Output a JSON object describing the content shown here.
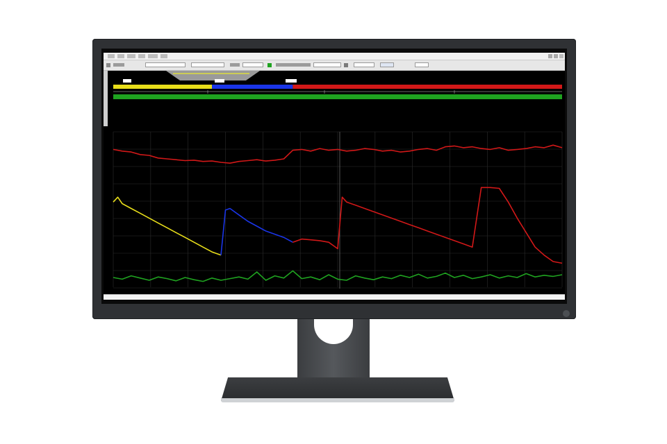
{
  "theme": {
    "bezel": "#2f3134",
    "plot_background": "#000000",
    "grid": "#2c2c2c",
    "colors": {
      "red": "#d21818",
      "yellow": "#e8de1a",
      "blue": "#1a35e8",
      "green": "#1fa320"
    }
  },
  "overview": {
    "timeline_segments": [
      {
        "name": "segment-yellow",
        "color": "#e8de1a",
        "from": 0.0,
        "to": 0.22
      },
      {
        "name": "segment-blue",
        "color": "#1a35e8",
        "from": 0.22,
        "to": 0.4
      },
      {
        "name": "segment-red",
        "color": "#d21818",
        "from": 0.4,
        "to": 1.0
      }
    ],
    "green_bar_color": "#1fa320"
  },
  "chart_data": {
    "type": "line",
    "title": "",
    "xlabel": "",
    "ylabel": "",
    "grid": true,
    "series": [
      {
        "color": "#d21818",
        "panel": "top",
        "x": [
          0,
          2,
          4,
          6,
          8,
          10,
          12,
          14,
          16,
          18,
          20,
          22,
          24,
          26,
          28,
          30,
          32,
          34,
          36,
          38,
          40,
          42,
          44,
          46,
          48,
          50,
          52,
          54,
          56,
          58,
          60,
          62,
          64,
          66,
          68,
          70,
          72,
          74,
          76,
          78,
          80,
          82,
          84,
          86,
          88,
          90,
          92,
          94,
          96,
          98,
          100
        ],
        "y": [
          0.72,
          0.68,
          0.66,
          0.6,
          0.58,
          0.52,
          0.5,
          0.48,
          0.46,
          0.47,
          0.44,
          0.45,
          0.42,
          0.4,
          0.44,
          0.46,
          0.48,
          0.45,
          0.47,
          0.5,
          0.7,
          0.72,
          0.68,
          0.74,
          0.7,
          0.72,
          0.68,
          0.7,
          0.74,
          0.72,
          0.68,
          0.7,
          0.66,
          0.68,
          0.72,
          0.74,
          0.7,
          0.78,
          0.8,
          0.76,
          0.78,
          0.74,
          0.72,
          0.76,
          0.7,
          0.72,
          0.74,
          0.78,
          0.76,
          0.82,
          0.76
        ]
      },
      {
        "color": "#e8de1a",
        "panel": "middle",
        "x": [
          0,
          1,
          2,
          4,
          6,
          8,
          10,
          12,
          14,
          16,
          18,
          20,
          22,
          24
        ],
        "y": [
          0.8,
          0.86,
          0.78,
          0.72,
          0.66,
          0.6,
          0.54,
          0.48,
          0.42,
          0.36,
          0.3,
          0.24,
          0.18,
          0.14
        ]
      },
      {
        "color": "#1a35e8",
        "panel": "middle",
        "x": [
          24,
          25,
          26,
          28,
          30,
          32,
          34,
          36,
          38,
          40
        ],
        "y": [
          0.14,
          0.7,
          0.72,
          0.64,
          0.56,
          0.5,
          0.44,
          0.4,
          0.36,
          0.3
        ]
      },
      {
        "color": "#d21818",
        "panel": "middle",
        "x": [
          40,
          42,
          44,
          46,
          48,
          50,
          51,
          52,
          54,
          56,
          58,
          60,
          62,
          64,
          66,
          68,
          70,
          72,
          74,
          76,
          78,
          80,
          82,
          84,
          86,
          88,
          90,
          92,
          94,
          96,
          98,
          100
        ],
        "y": [
          0.3,
          0.34,
          0.33,
          0.32,
          0.3,
          0.22,
          0.86,
          0.8,
          0.76,
          0.72,
          0.68,
          0.64,
          0.6,
          0.56,
          0.52,
          0.48,
          0.44,
          0.4,
          0.36,
          0.32,
          0.28,
          0.24,
          0.98,
          0.98,
          0.97,
          0.8,
          0.6,
          0.42,
          0.24,
          0.14,
          0.06,
          0.04
        ]
      },
      {
        "color": "#1fa320",
        "panel": "bottom",
        "x": [
          0,
          2,
          4,
          6,
          8,
          10,
          12,
          14,
          16,
          18,
          20,
          22,
          24,
          26,
          28,
          30,
          32,
          34,
          36,
          38,
          40,
          42,
          44,
          46,
          48,
          50,
          52,
          54,
          56,
          58,
          60,
          62,
          64,
          66,
          68,
          70,
          72,
          74,
          76,
          78,
          80,
          82,
          84,
          86,
          88,
          90,
          92,
          94,
          96,
          98,
          100
        ],
        "y": [
          0.5,
          0.44,
          0.56,
          0.48,
          0.4,
          0.52,
          0.46,
          0.38,
          0.5,
          0.42,
          0.36,
          0.48,
          0.4,
          0.46,
          0.52,
          0.44,
          0.7,
          0.4,
          0.56,
          0.48,
          0.74,
          0.46,
          0.52,
          0.42,
          0.6,
          0.44,
          0.4,
          0.56,
          0.48,
          0.42,
          0.52,
          0.46,
          0.58,
          0.5,
          0.62,
          0.48,
          0.54,
          0.66,
          0.5,
          0.58,
          0.46,
          0.52,
          0.6,
          0.48,
          0.56,
          0.5,
          0.64,
          0.52,
          0.58,
          0.54,
          0.6
        ]
      }
    ]
  }
}
